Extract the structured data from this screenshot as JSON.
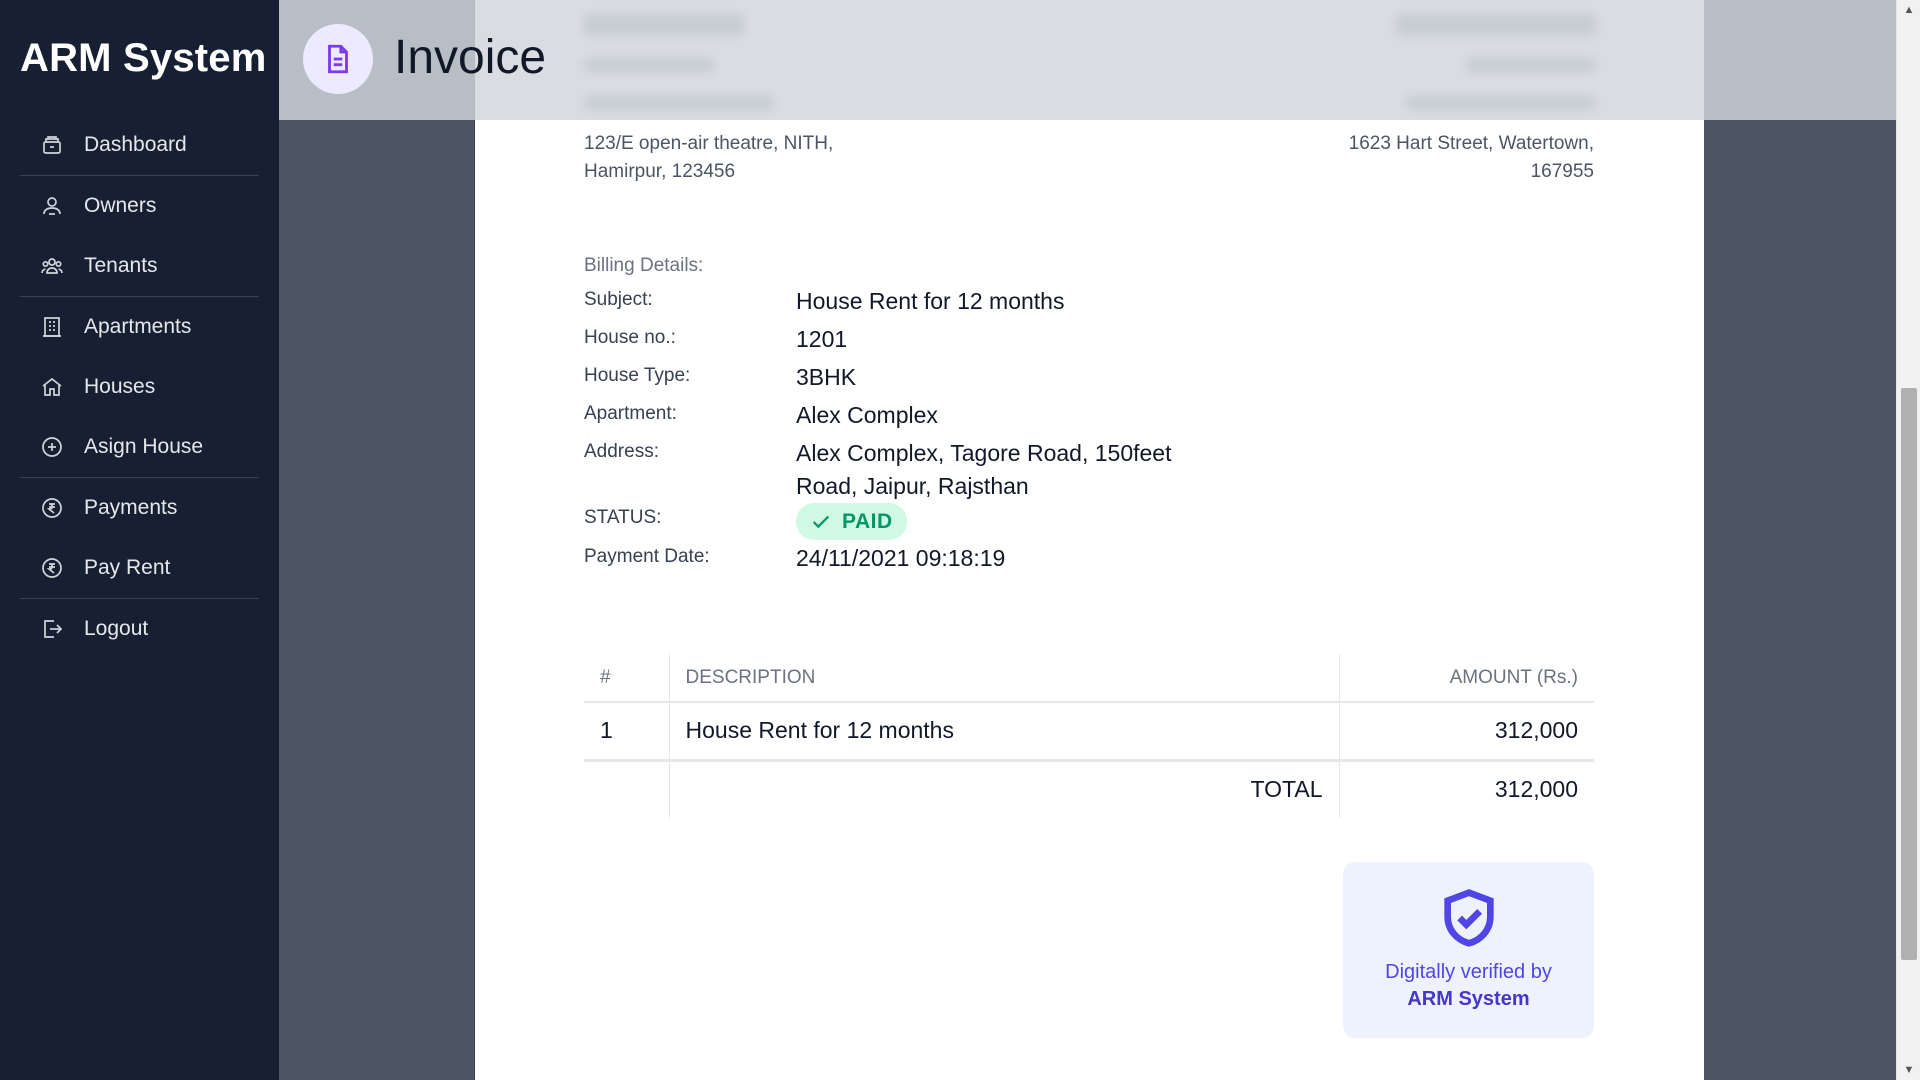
{
  "app": {
    "title": "ARM System"
  },
  "sidebar": {
    "items": [
      {
        "label": "Dashboard",
        "icon": "archive-icon"
      },
      {
        "label": "Owners",
        "icon": "users-icon"
      },
      {
        "label": "Tenants",
        "icon": "user-group-icon"
      },
      {
        "label": "Apartments",
        "icon": "building-icon"
      },
      {
        "label": "Houses",
        "icon": "home-icon"
      },
      {
        "label": "Asign House",
        "icon": "plus-circle-icon"
      },
      {
        "label": "Payments",
        "icon": "rupee-icon"
      },
      {
        "label": "Pay Rent",
        "icon": "rupee-icon"
      },
      {
        "label": "Logout",
        "icon": "logout-icon"
      }
    ]
  },
  "header": {
    "title": "Invoice",
    "icon": "document-icon"
  },
  "invoice": {
    "from": {
      "address_line1": "123/E open-air theatre, NITH,",
      "address_line2": "Hamirpur, 123456"
    },
    "to": {
      "address_line1": "1623 Hart Street, Watertown,",
      "address_line2": "167955"
    },
    "billing_title": "Billing Details:",
    "details": {
      "subject_label": "Subject:",
      "subject": "House Rent for 12 months",
      "house_no_label": "House no.:",
      "house_no": "1201",
      "house_type_label": "House Type:",
      "house_type": "3BHK",
      "apartment_label": "Apartment:",
      "apartment": "Alex Complex",
      "address_label": "Address:",
      "address_line1": "Alex Complex, Tagore Road, 150feet",
      "address_line2": "Road, Jaipur, Rajsthan",
      "status_label": "STATUS:",
      "status": "PAID",
      "payment_date_label": "Payment Date:",
      "payment_date": "24/11/2021 09:18:19"
    },
    "table": {
      "headers": {
        "num": "#",
        "description": "DESCRIPTION",
        "amount": "AMOUNT (Rs.)"
      },
      "rows": [
        {
          "num": "1",
          "description": "House Rent for 12 months",
          "amount": "312,000"
        }
      ],
      "total_label": "TOTAL",
      "total_amount": "312,000"
    },
    "verified": {
      "line1": "Digitally verified by",
      "line2": "ARM System",
      "icon": "shield-check-icon"
    }
  },
  "colors": {
    "sidebar_bg": "#172033",
    "accent": "#4f46e5",
    "paid_green": "#059669",
    "header_icon": "#7c3aed"
  }
}
